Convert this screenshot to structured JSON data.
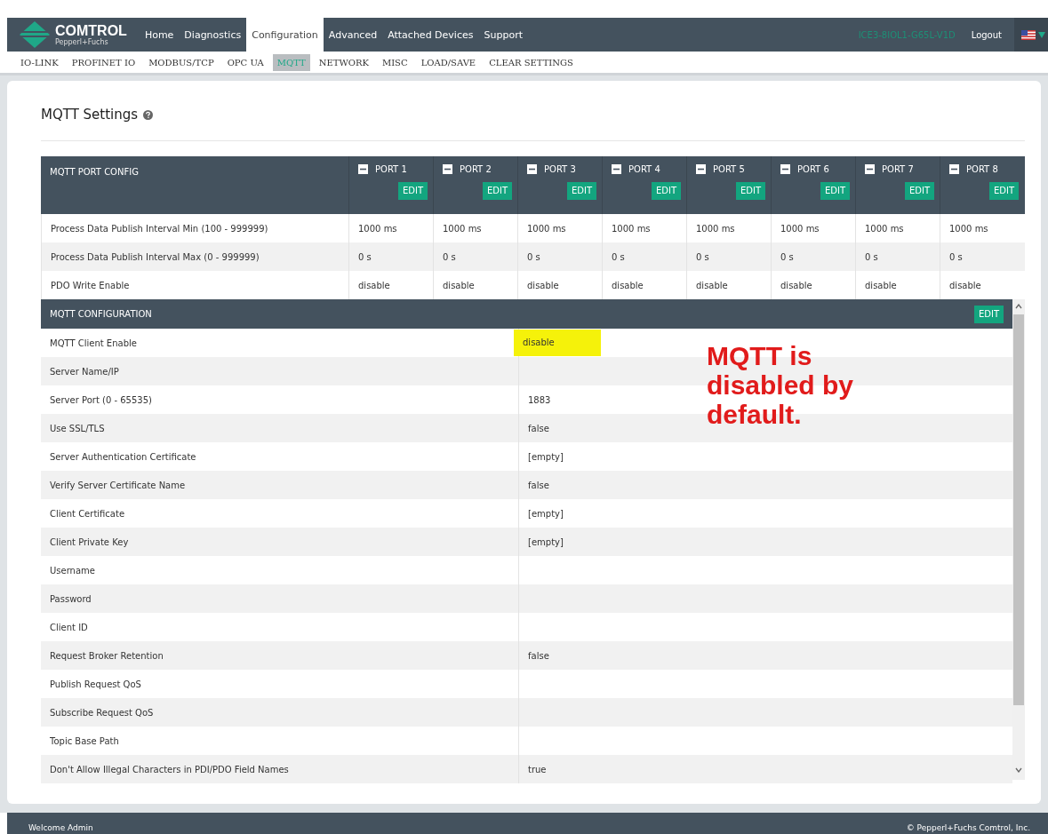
{
  "header": {
    "logo": "COMTROL",
    "logo_sub": "Pepperl+Fuchs",
    "nav": [
      {
        "label": "Home",
        "selected": false
      },
      {
        "label": "Diagnostics",
        "selected": false
      },
      {
        "label": "Configuration",
        "selected": true
      },
      {
        "label": "Advanced",
        "selected": false
      },
      {
        "label": "Attached Devices",
        "selected": false
      },
      {
        "label": "Support",
        "selected": false
      }
    ],
    "device": "ICE3-8IOL1-G65L-V1D",
    "logout": "Logout"
  },
  "subnav": [
    {
      "label": "IO-LINK",
      "selected": false
    },
    {
      "label": "PROFINET IO",
      "selected": false
    },
    {
      "label": "MODBUS/TCP",
      "selected": false
    },
    {
      "label": "OPC UA",
      "selected": false
    },
    {
      "label": "MQTT",
      "selected": true
    },
    {
      "label": "NETWORK",
      "selected": false
    },
    {
      "label": "MISC",
      "selected": false
    },
    {
      "label": "LOAD/SAVE",
      "selected": false
    },
    {
      "label": "CLEAR SETTINGS",
      "selected": false
    }
  ],
  "title": "MQTT Settings",
  "port_table": {
    "title": "MQTT PORT CONFIG",
    "ports": [
      {
        "label": "PORT 1",
        "edit": "EDIT"
      },
      {
        "label": "PORT 2",
        "edit": "EDIT"
      },
      {
        "label": "PORT 3",
        "edit": "EDIT"
      },
      {
        "label": "PORT 4",
        "edit": "EDIT"
      },
      {
        "label": "PORT 5",
        "edit": "EDIT"
      },
      {
        "label": "PORT 6",
        "edit": "EDIT"
      },
      {
        "label": "PORT 7",
        "edit": "EDIT"
      },
      {
        "label": "PORT 8",
        "edit": "EDIT"
      }
    ],
    "rows": [
      {
        "label": "Process Data Publish Interval Min (100 - 999999)",
        "values": [
          "1000 ms",
          "1000 ms",
          "1000 ms",
          "1000 ms",
          "1000 ms",
          "1000 ms",
          "1000 ms",
          "1000 ms"
        ]
      },
      {
        "label": "Process Data Publish Interval Max (0 - 999999)",
        "values": [
          "0 s",
          "0 s",
          "0 s",
          "0 s",
          "0 s",
          "0 s",
          "0 s",
          "0 s"
        ]
      },
      {
        "label": "PDO Write Enable",
        "values": [
          "disable",
          "disable",
          "disable",
          "disable",
          "disable",
          "disable",
          "disable",
          "disable"
        ]
      }
    ]
  },
  "config": {
    "title": "MQTT CONFIGURATION",
    "edit": "EDIT",
    "rows": [
      {
        "label": "MQTT Client Enable",
        "value": "disable",
        "highlighted": true
      },
      {
        "label": "Server Name/IP",
        "value": "",
        "highlighted": false
      },
      {
        "label": "Server Port (0 - 65535)",
        "value": "1883",
        "highlighted": false
      },
      {
        "label": "Use SSL/TLS",
        "value": "false",
        "highlighted": false
      },
      {
        "label": "Server Authentication Certificate",
        "value": "[empty]",
        "highlighted": false
      },
      {
        "label": "Verify Server Certificate Name",
        "value": "false",
        "highlighted": false
      },
      {
        "label": "Client Certificate",
        "value": "[empty]",
        "highlighted": false
      },
      {
        "label": "Client Private Key",
        "value": "[empty]",
        "highlighted": false
      },
      {
        "label": "Username",
        "value": "",
        "highlighted": false
      },
      {
        "label": "Password",
        "value": "",
        "highlighted": false
      },
      {
        "label": "Client ID",
        "value": "",
        "highlighted": false
      },
      {
        "label": "Request Broker Retention",
        "value": "false",
        "highlighted": false
      },
      {
        "label": "Publish Request QoS",
        "value": "",
        "highlighted": false
      },
      {
        "label": "Subscribe Request QoS",
        "value": "",
        "highlighted": false
      },
      {
        "label": "Topic Base Path",
        "value": "",
        "highlighted": false
      },
      {
        "label": "Don't Allow Illegal Characters in PDI/PDO Field Names",
        "value": "true",
        "highlighted": false
      }
    ]
  },
  "annotation": "MQTT is disabled by default.",
  "footer": {
    "left": "Welcome Admin",
    "right": "© Pepperl+Fuchs Comtrol, Inc."
  }
}
